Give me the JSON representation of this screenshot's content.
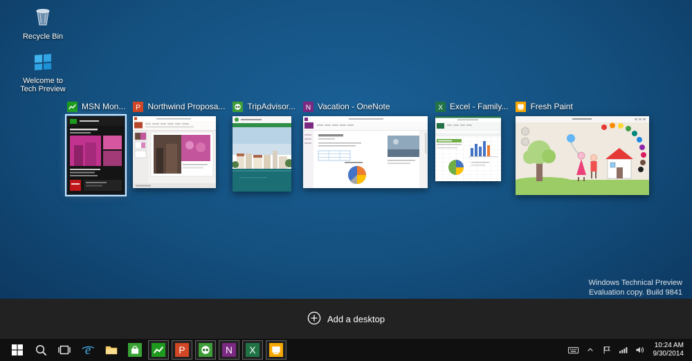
{
  "desktop": {
    "icons": [
      {
        "label": "Recycle Bin"
      },
      {
        "label": "Welcome to Tech Preview"
      }
    ],
    "watermark_line1": "Windows Technical Preview",
    "watermark_line2": "Evaluation copy. Build 9841"
  },
  "task_view": {
    "add_desktop_label": "Add a desktop",
    "windows": [
      {
        "title": "MSN Mon...",
        "app": "MSN Money",
        "selected": true
      },
      {
        "title": "Northwind Proposa...",
        "app": "PowerPoint",
        "selected": false
      },
      {
        "title": "TripAdvisor...",
        "app": "TripAdvisor",
        "selected": false
      },
      {
        "title": "Vacation - OneNote",
        "app": "OneNote",
        "selected": false
      },
      {
        "title": "Excel - Family...",
        "app": "Excel",
        "selected": false
      },
      {
        "title": "Fresh Paint",
        "app": "Fresh Paint",
        "selected": false
      }
    ]
  },
  "taskbar": {
    "icons": [
      "start",
      "search",
      "task-view",
      "internet-explorer",
      "file-explorer",
      "store",
      "msn-money",
      "powerpoint",
      "tripadvisor",
      "onenote",
      "excel",
      "fresh-paint"
    ],
    "tray_icons": [
      "keyboard",
      "chevron-up",
      "flag",
      "network",
      "volume"
    ],
    "clock": {
      "time": "10:24 AM",
      "date": "9/30/2014"
    }
  },
  "glyphs": {
    "powerpoint": "P",
    "onenote": "N",
    "excel": "X",
    "ie": "e"
  },
  "colors": {
    "msn_green": "#1e9b1e",
    "powerpoint_orange": "#d24726",
    "tripadvisor_green": "#3f9e3a",
    "onenote_purple": "#7b2982",
    "excel_green": "#217346",
    "fresh_paint_yellow": "#f7a800",
    "desktop_blue": "#14507f"
  }
}
